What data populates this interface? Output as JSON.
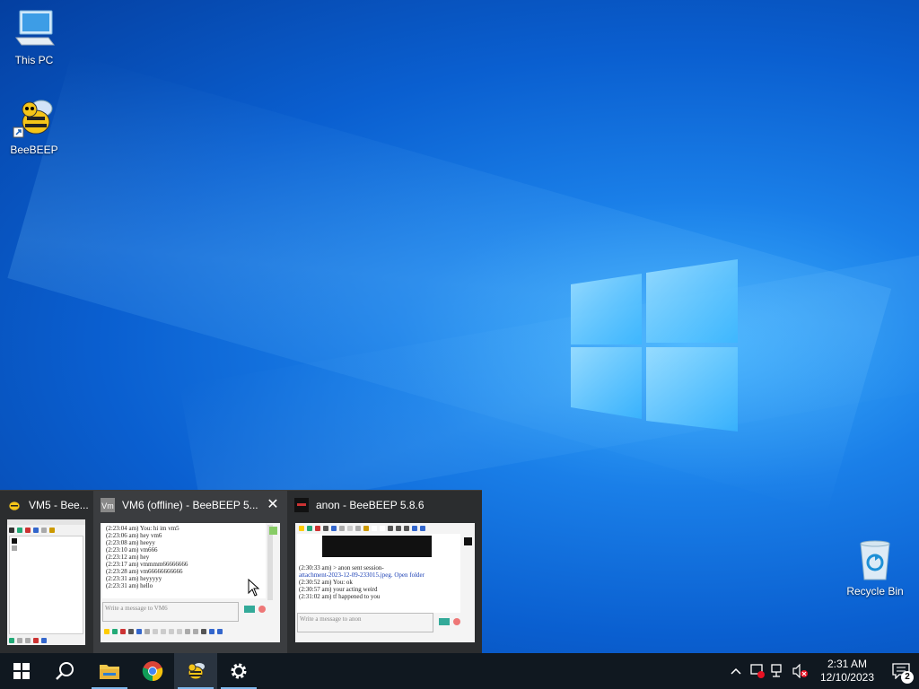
{
  "desktop": {
    "icons": [
      {
        "label": "This PC",
        "icon": "this-pc-icon"
      },
      {
        "label": "BeeBEEP",
        "icon": "beebeep-icon"
      },
      {
        "label": "Recycle Bin",
        "icon": "recycle-bin-icon"
      }
    ]
  },
  "thumbnails": [
    {
      "title": "VM5 - Bee...",
      "icon": "beebeep-icon"
    },
    {
      "title": "VM6 (offline) - BeeBEEP 5...",
      "icon": "vm-icon",
      "close_label": "✕",
      "preview": {
        "messages": [
          "(2:23:04 am) You: hi im vm5",
          "(2:23:06 am)  hey vm6",
          "(2:23:08 am)  heeyy",
          "(2:23:10 am)  vm666",
          "(2:23:12 am)  hey",
          "(2:23:17 am)  vmmmm66666666",
          "(2:23:28 am)  vm66666666666",
          "(2:23:31 am)  heyyyyy",
          "(2:23:31 am)  hello"
        ],
        "input_placeholder": "Write a message to VM6"
      }
    },
    {
      "title": "anon - BeeBEEP 5.8.6",
      "icon": "anon-icon",
      "preview": {
        "messages": [
          "(2:30:33 am) > anon sent session-",
          "attachment-2023-12-09-233015.jpeg. Open folder",
          "(2:30:52 am) You: ok",
          "(2:30:57 am)  your acting weird",
          "(2:31:02 am)  tf happened to you"
        ],
        "input_placeholder": "Write a message to anon"
      }
    }
  ],
  "taskbar": {
    "apps": [
      {
        "name": "start",
        "icon": "windows-start-icon"
      },
      {
        "name": "search",
        "icon": "search-icon"
      },
      {
        "name": "file-explorer",
        "icon": "folder-icon"
      },
      {
        "name": "chrome",
        "icon": "chrome-icon"
      },
      {
        "name": "beebeep",
        "icon": "beebeep-icon"
      },
      {
        "name": "settings",
        "icon": "gear-icon"
      }
    ],
    "clock": {
      "time": "2:31 AM",
      "date": "12/10/2023"
    },
    "notifications_count": "2"
  },
  "colors": {
    "accent": "#0a5fd0",
    "taskbar": "#101820",
    "thumb_bg": "#2b2d2f"
  }
}
